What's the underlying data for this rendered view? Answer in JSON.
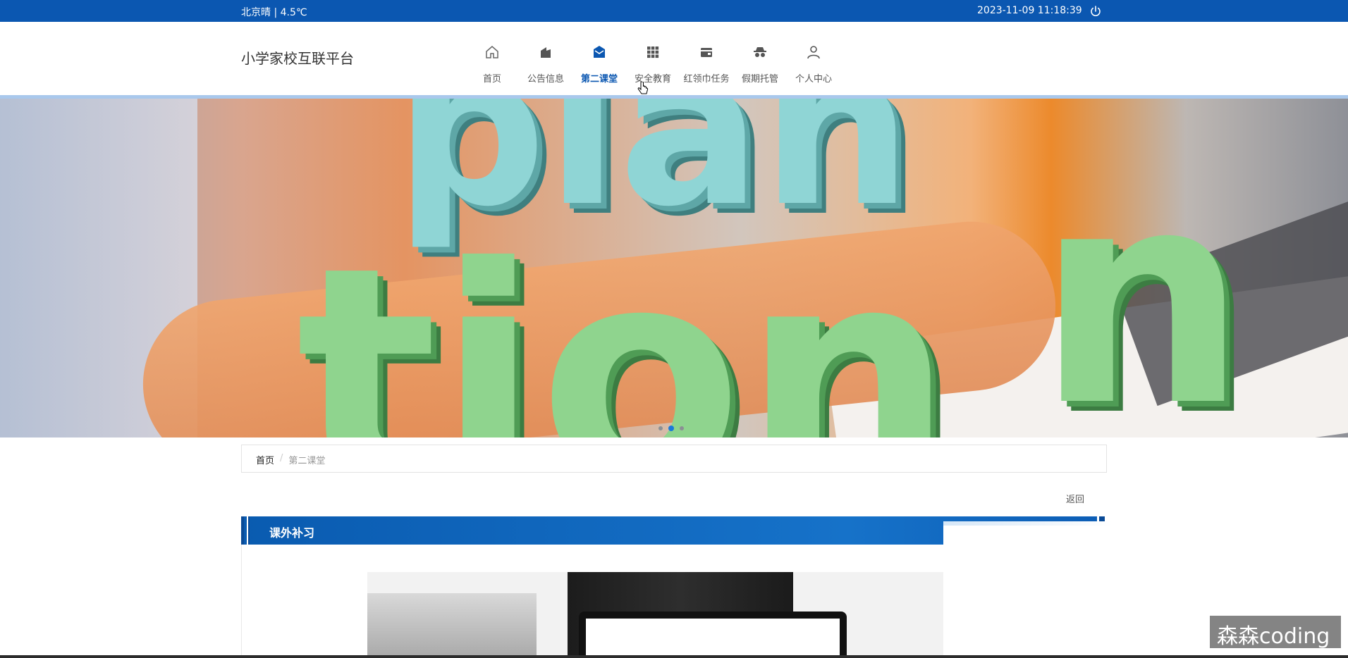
{
  "topbar": {
    "weather": "北京晴 | 4.5℃",
    "datetime": "2023-11-09  11:18:39",
    "power_icon": "power-icon"
  },
  "header": {
    "brand": "小学家校互联平台"
  },
  "nav": {
    "items": [
      {
        "label": "首页",
        "icon": "home-icon"
      },
      {
        "label": "公告信息",
        "icon": "notice-icon"
      },
      {
        "label": "第二课堂",
        "icon": "envelope-icon",
        "active": true
      },
      {
        "label": "安全教育",
        "icon": "grid-icon"
      },
      {
        "label": "红领巾任务",
        "icon": "wallet-icon"
      },
      {
        "label": "假期托管",
        "icon": "incognito-icon"
      },
      {
        "label": "个人中心",
        "icon": "user-icon"
      }
    ],
    "active_color": "#0b57b1"
  },
  "banner": {
    "words": [
      "plan",
      "tion",
      "n"
    ],
    "slides": 3,
    "active_slide": 2
  },
  "breadcrumb": {
    "home": "首页",
    "separator": "/",
    "current": "第二课堂"
  },
  "actions": {
    "back": "返回"
  },
  "section": {
    "title": "课外补习"
  },
  "watermark": "森森coding",
  "colors": {
    "primary": "#0b57b1",
    "accent": "#1a7ad9"
  }
}
